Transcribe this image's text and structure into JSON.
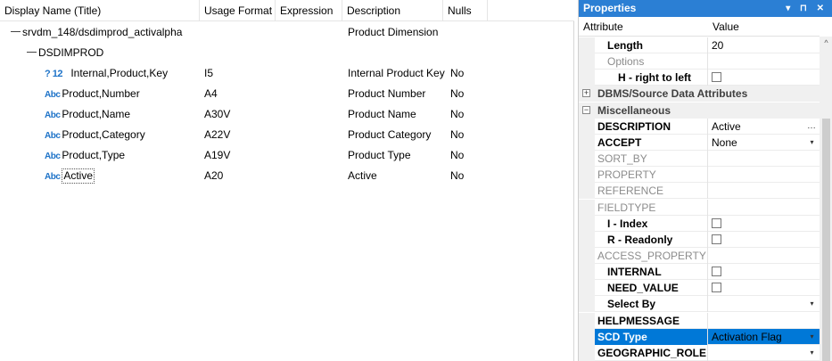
{
  "grid": {
    "columns": [
      "Display Name (Title)",
      "Usage Format",
      "Expression",
      "Description",
      "Nulls"
    ],
    "tree_root": "srvdm_148/dsdimprod_activalpha",
    "tree_root_description": "Product Dimension",
    "segment": "DSDIMPROD",
    "rows": [
      {
        "icon": "key",
        "icon_text": "? 12",
        "name": "Internal,Product,Key",
        "format": "I5",
        "expression": "",
        "description": "Internal Product Key",
        "nulls": "No"
      },
      {
        "icon": "abc",
        "icon_text": "Abc",
        "name": "Product,Number",
        "format": "A4",
        "expression": "",
        "description": "Product Number",
        "nulls": "No"
      },
      {
        "icon": "abc",
        "icon_text": "Abc",
        "name": "Product,Name",
        "format": "A30V",
        "expression": "",
        "description": "Product Name",
        "nulls": "No"
      },
      {
        "icon": "abc",
        "icon_text": "Abc",
        "name": "Product,Category",
        "format": "A22V",
        "expression": "",
        "description": "Product Category",
        "nulls": "No"
      },
      {
        "icon": "abc",
        "icon_text": "Abc",
        "name": "Product,Type",
        "format": "A19V",
        "expression": "",
        "description": "Product Type",
        "nulls": "No"
      },
      {
        "icon": "abc",
        "icon_text": "Abc",
        "name": "Active",
        "format": "A20",
        "expression": "",
        "description": "Active",
        "nulls": "No"
      }
    ]
  },
  "properties": {
    "title": "Properties",
    "title_buttons": "▾ ⊓ ✕",
    "header_attribute": "Attribute",
    "header_value": "Value",
    "rows": [
      {
        "name": "Length",
        "value": "20",
        "kind": "plain",
        "indent": true
      },
      {
        "name": "Options",
        "value": "",
        "kind": "dim",
        "indent": true
      },
      {
        "name": "H - right to left",
        "value": "",
        "kind": "check",
        "indent": true,
        "subindent": true
      },
      {
        "name": "DBMS/Source Data Attributes",
        "value": "",
        "kind": "category",
        "expander": "⊞"
      },
      {
        "name": "Miscellaneous",
        "value": "",
        "kind": "category",
        "expander": "⊟"
      },
      {
        "name": "DESCRIPTION",
        "value": "Active",
        "kind": "ellipsis"
      },
      {
        "name": "ACCEPT",
        "value": "None",
        "kind": "dropdown"
      },
      {
        "name": "SORT_BY",
        "value": "",
        "kind": "dim"
      },
      {
        "name": "PROPERTY",
        "value": "",
        "kind": "dim"
      },
      {
        "name": "REFERENCE",
        "value": "",
        "kind": "dim"
      },
      {
        "name": "FIELDTYPE",
        "value": "",
        "kind": "dim"
      },
      {
        "name": "I - Index",
        "value": "",
        "kind": "check",
        "indent": true
      },
      {
        "name": "R - Readonly",
        "value": "",
        "kind": "check",
        "indent": true
      },
      {
        "name": "ACCESS_PROPERTY",
        "value": "",
        "kind": "dim"
      },
      {
        "name": "INTERNAL",
        "value": "",
        "kind": "check",
        "indent": true
      },
      {
        "name": "NEED_VALUE",
        "value": "",
        "kind": "check",
        "indent": true
      },
      {
        "name": "Select By",
        "value": "",
        "kind": "dropdown",
        "indent": true
      },
      {
        "name": "HELPMESSAGE",
        "value": "",
        "kind": "plain"
      },
      {
        "name": "SCD Type",
        "value": "Activation Flag",
        "kind": "dropdown",
        "selected": true
      },
      {
        "name": "GEOGRAPHIC_ROLE",
        "value": "",
        "kind": "dropdown"
      }
    ]
  }
}
